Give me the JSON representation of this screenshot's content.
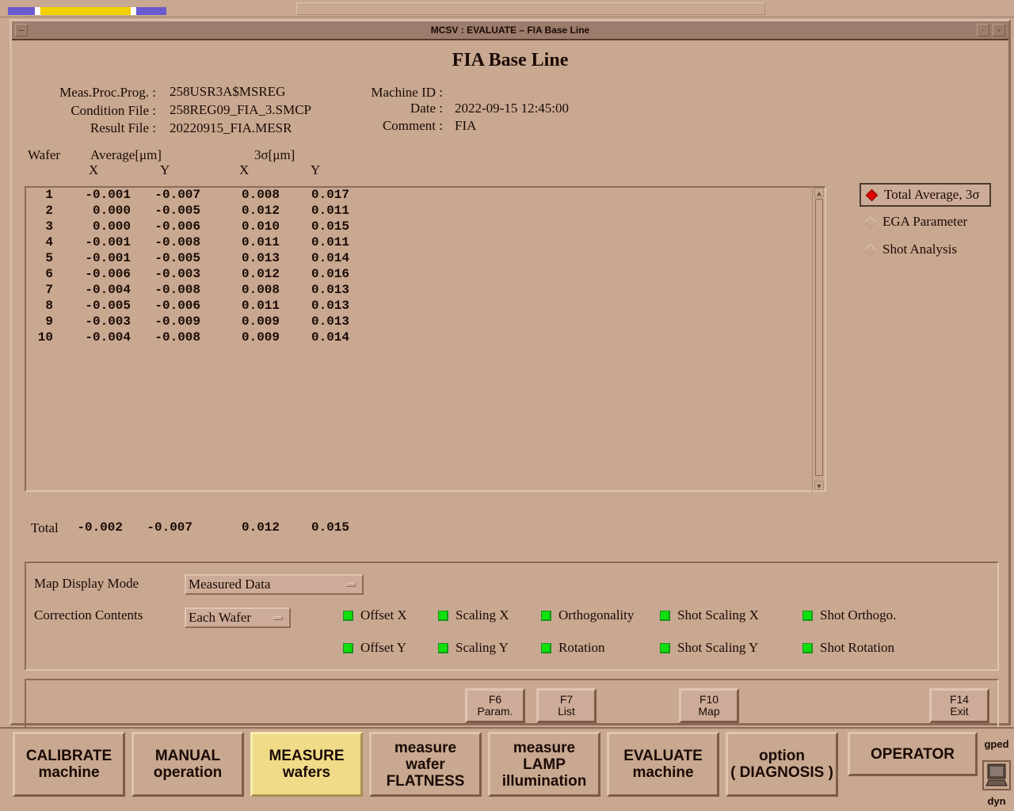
{
  "topbar": {
    "workspace_colors": [
      "#6a5ad0",
      "#ffffff",
      "#f0d000",
      "#ffffff",
      "#6a5ad0"
    ]
  },
  "window": {
    "title": "MCSV : EVALUATE – FIA Base Line"
  },
  "page": {
    "title": "FIA Base Line"
  },
  "info": {
    "left": [
      {
        "label": "Meas.Proc.Prog. :",
        "value": "258USR3A$MSREG"
      },
      {
        "label": "Condition File :",
        "value": "258REG09_FIA_3.SMCP"
      },
      {
        "label": "Result File :",
        "value": "20220915_FIA.MESR"
      }
    ],
    "right": [
      {
        "label": "Machine ID :",
        "value": ""
      },
      {
        "label": "Date :",
        "value": "2022-09-15 12:45:00"
      },
      {
        "label": "Comment :",
        "value": "FIA"
      }
    ]
  },
  "table": {
    "headers": {
      "wafer": "Wafer",
      "average": "Average[μm]",
      "sigma": "3σ[μm]",
      "x": "X",
      "y": "Y"
    },
    "rows": [
      {
        "wafer": "1",
        "avg_x": "-0.001",
        "avg_y": "-0.007",
        "sig_x": "0.008",
        "sig_y": "0.017"
      },
      {
        "wafer": "2",
        "avg_x": "0.000",
        "avg_y": "-0.005",
        "sig_x": "0.012",
        "sig_y": "0.011"
      },
      {
        "wafer": "3",
        "avg_x": "0.000",
        "avg_y": "-0.006",
        "sig_x": "0.010",
        "sig_y": "0.015"
      },
      {
        "wafer": "4",
        "avg_x": "-0.001",
        "avg_y": "-0.008",
        "sig_x": "0.011",
        "sig_y": "0.011"
      },
      {
        "wafer": "5",
        "avg_x": "-0.001",
        "avg_y": "-0.005",
        "sig_x": "0.013",
        "sig_y": "0.014"
      },
      {
        "wafer": "6",
        "avg_x": "-0.006",
        "avg_y": "-0.003",
        "sig_x": "0.012",
        "sig_y": "0.016"
      },
      {
        "wafer": "7",
        "avg_x": "-0.004",
        "avg_y": "-0.008",
        "sig_x": "0.008",
        "sig_y": "0.013"
      },
      {
        "wafer": "8",
        "avg_x": "-0.005",
        "avg_y": "-0.006",
        "sig_x": "0.011",
        "sig_y": "0.013"
      },
      {
        "wafer": "9",
        "avg_x": "-0.003",
        "avg_y": "-0.009",
        "sig_x": "0.009",
        "sig_y": "0.013"
      },
      {
        "wafer": "10",
        "avg_x": "-0.004",
        "avg_y": "-0.008",
        "sig_x": "0.009",
        "sig_y": "0.014"
      }
    ],
    "total": {
      "label": "Total",
      "avg_x": "-0.002",
      "avg_y": "-0.007",
      "sig_x": "0.012",
      "sig_y": "0.015"
    }
  },
  "view_options": [
    {
      "label": "Total Average, 3σ",
      "selected": true
    },
    {
      "label": "EGA Parameter",
      "selected": false
    },
    {
      "label": "Shot Analysis",
      "selected": false
    }
  ],
  "settings": {
    "map_display_mode": {
      "label": "Map Display Mode",
      "value": "Measured Data"
    },
    "correction_contents": {
      "label": "Correction Contents",
      "value": "Each Wafer"
    },
    "corrections": [
      {
        "label": "Offset X",
        "on": true
      },
      {
        "label": "Scaling X",
        "on": true
      },
      {
        "label": "Orthogonality",
        "on": true
      },
      {
        "label": "Shot Scaling X",
        "on": true
      },
      {
        "label": "Shot Orthogo.",
        "on": true
      },
      {
        "label": "Offset Y",
        "on": true
      },
      {
        "label": "Scaling Y",
        "on": true
      },
      {
        "label": "Rotation",
        "on": true
      },
      {
        "label": "Shot Scaling Y",
        "on": true
      },
      {
        "label": "Shot Rotation",
        "on": true
      }
    ],
    "indicator_color": "#10e010"
  },
  "function_keys": [
    {
      "key": "F6",
      "label": "Param."
    },
    {
      "key": "F7",
      "label": "List"
    },
    {
      "key": "F10",
      "label": "Map"
    },
    {
      "key": "F14",
      "label": "Exit"
    }
  ],
  "nav": [
    {
      "lines": [
        "CALIBRATE",
        "machine"
      ],
      "active": false
    },
    {
      "lines": [
        "MANUAL",
        "operation"
      ],
      "active": false
    },
    {
      "lines": [
        "MEASURE",
        "wafers"
      ],
      "active": true
    },
    {
      "lines": [
        "measure",
        "wafer",
        "FLATNESS"
      ],
      "active": false
    },
    {
      "lines": [
        "measure",
        "LAMP",
        "illumination"
      ],
      "active": false
    },
    {
      "lines": [
        "EVALUATE",
        "machine"
      ],
      "active": false
    },
    {
      "lines": [
        "option",
        "( DIAGNOSIS )"
      ],
      "active": false
    },
    {
      "lines": [
        "OPERATOR"
      ],
      "active": false
    }
  ],
  "side": {
    "top_label": "gped",
    "bottom_label": "dyn"
  }
}
